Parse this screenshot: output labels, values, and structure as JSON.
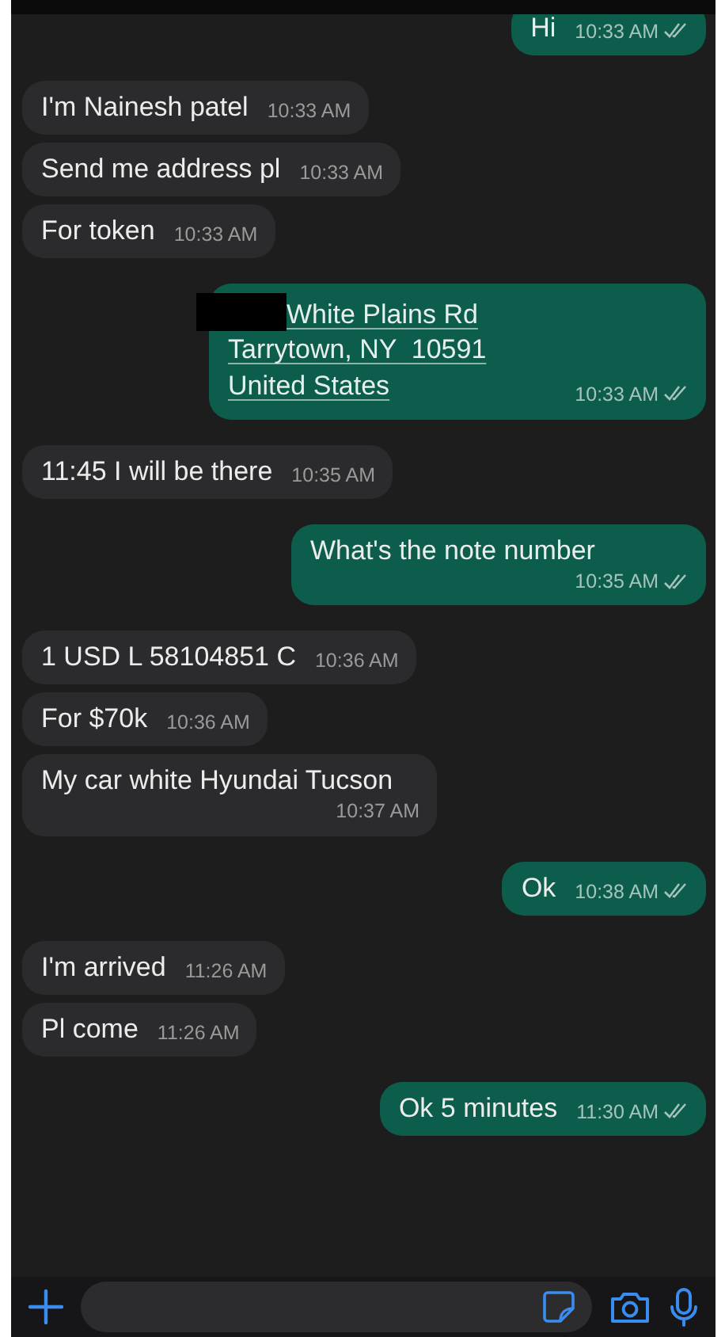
{
  "messages": [
    {
      "outgoing": true,
      "kind": "text",
      "text": "Hi",
      "time": "10:33 AM",
      "read": true
    },
    {
      "outgoing": false,
      "kind": "text",
      "text": "I'm Nainesh patel",
      "time": "10:33 AM"
    },
    {
      "outgoing": false,
      "kind": "text",
      "text": "Send me address pl",
      "time": "10:33 AM"
    },
    {
      "outgoing": false,
      "kind": "text",
      "text": "For token",
      "time": "10:33 AM"
    },
    {
      "outgoing": true,
      "kind": "address",
      "redacted": true,
      "lines": [
        "White Plains Rd",
        "Tarrytown, NY  10591",
        "United States"
      ],
      "time": "10:33 AM",
      "read": true
    },
    {
      "outgoing": false,
      "kind": "text",
      "text": "11:45 I will be there",
      "time": "10:35 AM"
    },
    {
      "outgoing": true,
      "kind": "text",
      "text": "What's the note number",
      "time": "10:35 AM",
      "read": true
    },
    {
      "outgoing": false,
      "kind": "text",
      "text": "1 USD L 58104851 C",
      "time": "10:36 AM"
    },
    {
      "outgoing": false,
      "kind": "text",
      "text": "For $70k",
      "time": "10:36 AM"
    },
    {
      "outgoing": false,
      "kind": "text",
      "text": "My car white Hyundai Tucson",
      "time": "10:37 AM"
    },
    {
      "outgoing": true,
      "kind": "text",
      "text": "Ok",
      "time": "10:38 AM",
      "read": true
    },
    {
      "outgoing": false,
      "kind": "text",
      "text": "I'm arrived",
      "time": "11:26 AM"
    },
    {
      "outgoing": false,
      "kind": "text",
      "text": "Pl come",
      "time": "11:26 AM"
    },
    {
      "outgoing": true,
      "kind": "text",
      "text": "Ok 5 minutes",
      "time": "11:30 AM",
      "read": true
    }
  ]
}
